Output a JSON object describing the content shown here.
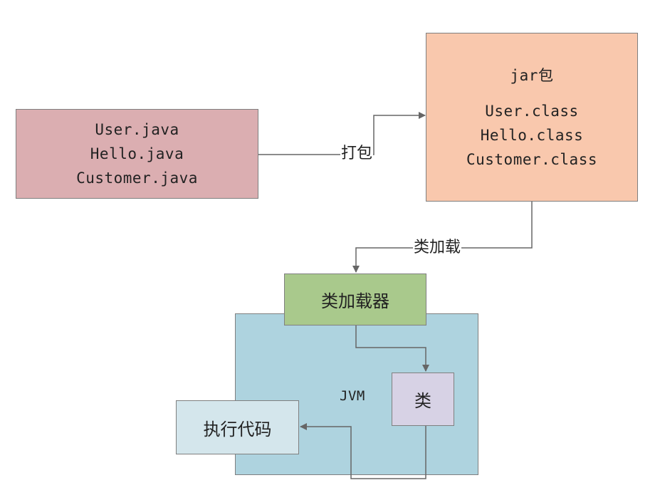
{
  "source_box": {
    "lines": [
      "User.java",
      "Hello.java",
      "Customer.java"
    ],
    "fill": "#dbaeb1"
  },
  "jar_box": {
    "title": "jar包",
    "lines": [
      "User.class",
      "Hello.class",
      "Customer.class"
    ],
    "fill": "#f9c8ad"
  },
  "edges": {
    "package_label": "打包",
    "classload_label": "类加载"
  },
  "jvm_box": {
    "label": "JVM",
    "fill": "#aed3df"
  },
  "classloader_box": {
    "label": "类加载器",
    "fill": "#a9c98c"
  },
  "class_box": {
    "label": "类",
    "fill": "#d7d2e5"
  },
  "exec_box": {
    "label": "执行代码",
    "fill": "#d4e6ec"
  },
  "colors": {
    "stroke": "#7f7f7f",
    "connector": "#666666"
  }
}
